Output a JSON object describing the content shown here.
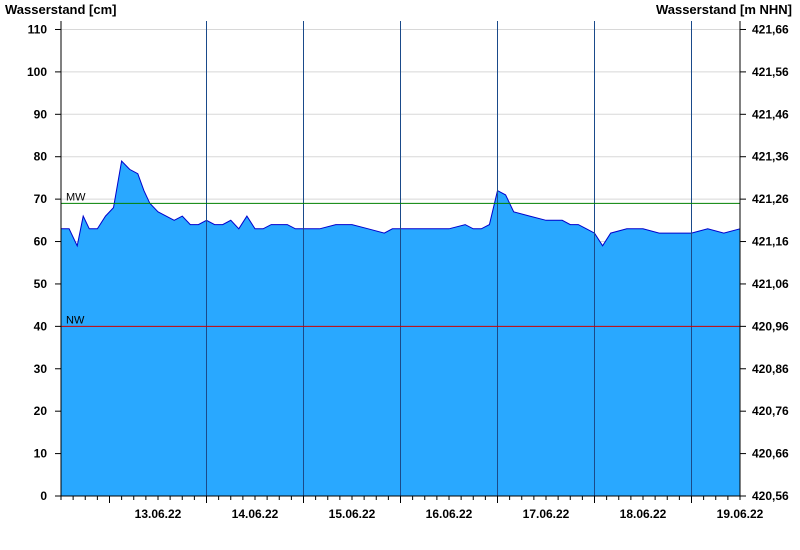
{
  "chart_data": {
    "type": "area",
    "y_left_label": "Wasserstand [cm]",
    "y_right_label": "Wasserstand [m NHN]",
    "ylim": [
      0,
      112
    ],
    "y_left_ticks": [
      0,
      10,
      20,
      30,
      40,
      50,
      60,
      70,
      80,
      90,
      100,
      110
    ],
    "y_right_ticks": [
      "420,56",
      "420,66",
      "420,76",
      "420,86",
      "420,96",
      "421,06",
      "421,16",
      "421,26",
      "421,36",
      "421,46",
      "421,56",
      "421,66"
    ],
    "x_range_days": [
      "12.06.22 12:00",
      "19.06.22 12:00"
    ],
    "x_tick_labels": [
      "13.06.22",
      "14.06.22",
      "15.06.22",
      "16.06.22",
      "17.06.22",
      "18.06.22",
      "19.06.22"
    ],
    "reference_lines": [
      {
        "name": "MW",
        "value": 69,
        "color": "#008000"
      },
      {
        "name": "NW",
        "value": 40,
        "color": "#cc0000"
      }
    ],
    "fill_color": "#29a8ff",
    "line_color": "#0000cc",
    "gridlines": true,
    "series": [
      {
        "x": [
          "12.06.22 12:00",
          "12.06.22 14:00",
          "12.06.22 16:00",
          "12.06.22 17:30",
          "12.06.22 19:00",
          "12.06.22 21:00",
          "12.06.22 23:00",
          "13.06.22 01:00",
          "13.06.22 03:00",
          "13.06.22 05:00",
          "13.06.22 07:00",
          "13.06.22 08:30",
          "13.06.22 10:00",
          "13.06.22 12:00",
          "13.06.22 14:00",
          "13.06.22 16:00",
          "13.06.22 18:00",
          "13.06.22 20:00",
          "13.06.22 22:00",
          "14.06.22 00:00",
          "14.06.22 02:00",
          "14.06.22 04:00",
          "14.06.22 06:00",
          "14.06.22 08:00",
          "14.06.22 10:00",
          "14.06.22 12:00",
          "14.06.22 14:00",
          "14.06.22 16:00",
          "14.06.22 18:00",
          "14.06.22 20:00",
          "14.06.22 22:00",
          "15.06.22 00:00",
          "15.06.22 04:00",
          "15.06.22 08:00",
          "15.06.22 12:00",
          "15.06.22 16:00",
          "15.06.22 20:00",
          "15.06.22 22:00",
          "16.06.22 00:00",
          "16.06.22 04:00",
          "16.06.22 08:00",
          "16.06.22 12:00",
          "16.06.22 16:00",
          "16.06.22 18:00",
          "16.06.22 20:00",
          "16.06.22 22:00",
          "17.06.22 00:00",
          "17.06.22 02:00",
          "17.06.22 04:00",
          "17.06.22 08:00",
          "17.06.22 12:00",
          "17.06.22 16:00",
          "17.06.22 18:00",
          "17.06.22 20:00",
          "17.06.22 22:00",
          "18.06.22 00:00",
          "18.06.22 02:00",
          "18.06.22 04:00",
          "18.06.22 08:00",
          "18.06.22 12:00",
          "18.06.22 16:00",
          "18.06.22 20:00",
          "19.06.22 00:00",
          "19.06.22 04:00",
          "19.06.22 08:00",
          "19.06.22 12:00"
        ],
        "y": [
          63,
          63,
          59,
          66,
          63,
          63,
          66,
          68,
          79,
          77,
          76,
          72,
          69,
          67,
          66,
          65,
          66,
          64,
          64,
          65,
          64,
          64,
          65,
          63,
          66,
          63,
          63,
          64,
          64,
          64,
          63,
          63,
          63,
          64,
          64,
          63,
          62,
          63,
          63,
          63,
          63,
          63,
          64,
          63,
          63,
          64,
          72,
          71,
          67,
          66,
          65,
          65,
          64,
          64,
          63,
          62,
          59,
          62,
          63,
          63,
          62,
          62,
          62,
          63,
          62,
          63
        ]
      }
    ]
  }
}
